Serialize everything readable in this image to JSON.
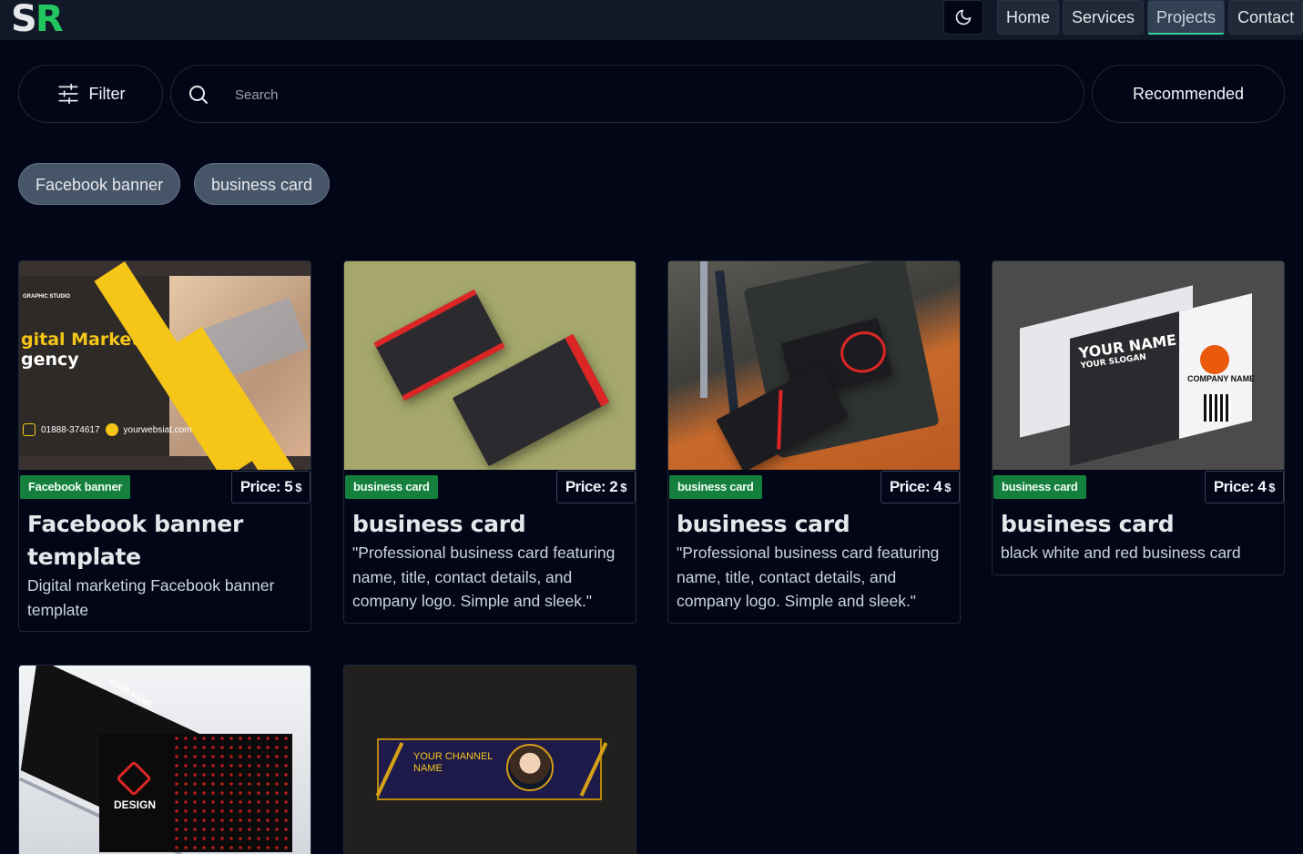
{
  "brand": {
    "logo_s": "S",
    "logo_r": "R"
  },
  "nav": {
    "items": [
      "Home",
      "Services",
      "Projects",
      "Contact"
    ],
    "active": "Projects"
  },
  "toolbar": {
    "filter_label": "Filter",
    "search_placeholder": "Search",
    "search_value": "",
    "sort_label": "Recommended"
  },
  "chips": [
    "Facebook banner",
    "business card"
  ],
  "cards": [
    {
      "tag": "Facebook banner",
      "price_label": "Price: 5",
      "currency": "$",
      "title": "Facebook banner template",
      "description": "Digital marketing Facebook banner template",
      "thumb_text": {
        "studio": "GRAPHIC STUDIO",
        "line1": "gital Marketig",
        "line2": "gency",
        "phone": "01888-374617",
        "web": "yourwebsiat.com"
      }
    },
    {
      "tag": "business card",
      "price_label": "Price: 2",
      "currency": "$",
      "title": "business card",
      "description": "\"Professional business card featuring name, title, contact details, and company logo. Simple and sleek.\""
    },
    {
      "tag": "business card",
      "price_label": "Price: 4",
      "currency": "$",
      "title": "business card",
      "description": "\"Professional business card featuring name, title, contact details, and company logo. Simple and sleek.\""
    },
    {
      "tag": "business card",
      "price_label": "Price: 4",
      "currency": "$",
      "title": "business card",
      "description": "black white and red business card",
      "thumb_text": {
        "your_name": "YOUR NAME",
        "slogan": "YOUR SLOGAN",
        "company": "COMPANY NAME"
      }
    },
    {
      "thumb_text": {
        "brand": "DESIGN",
        "name": "YOUR NAME"
      }
    },
    {
      "thumb_text": {
        "channel1": "YOUR CHANNEL",
        "channel2": "NAME"
      }
    }
  ],
  "colors": {
    "background": "#020617",
    "accent": "#22c55e",
    "tag": "#15803d",
    "chip": "#475569"
  },
  "icons": {
    "theme": "moon-icon",
    "filter": "sliders-icon",
    "search": "search-icon"
  }
}
